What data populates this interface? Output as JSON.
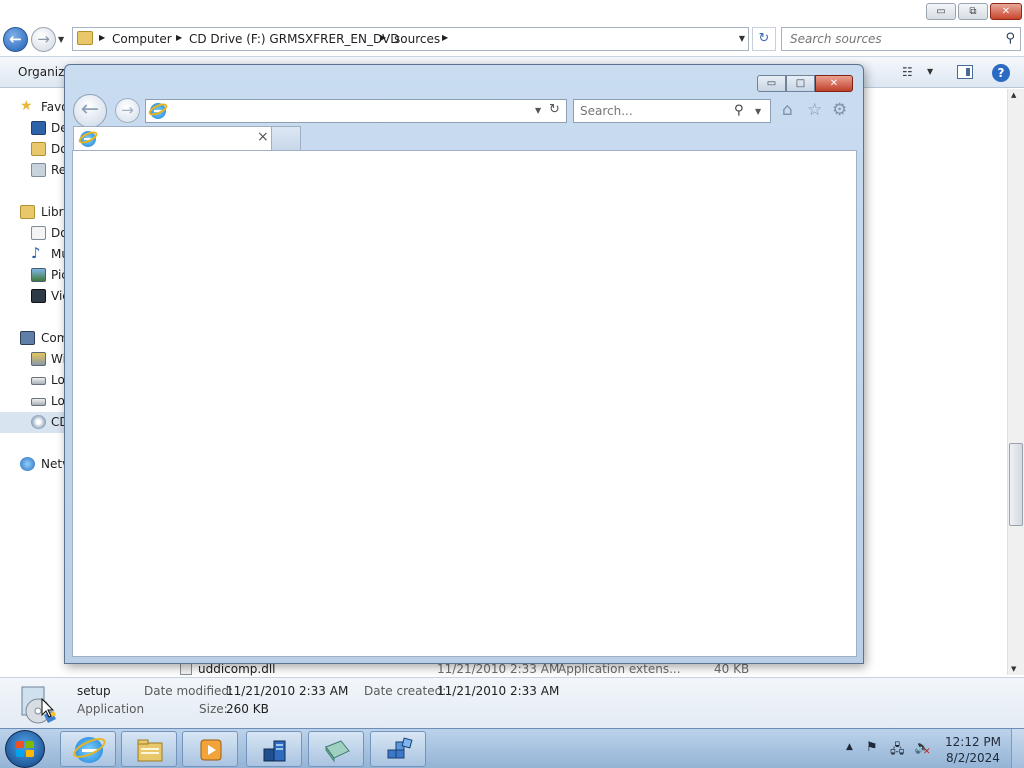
{
  "explorer": {
    "titlebar": {
      "minimize_glyph": "▭",
      "maximize_glyph": "⧉",
      "close_glyph": "✕"
    },
    "nav": {
      "back_glyph": "←",
      "forward_glyph": "→",
      "breadcrumbs": [
        "Computer",
        "CD Drive (F:) GRMSXFRER_EN_DVD",
        "sources"
      ],
      "refresh_glyph": "↻",
      "search_placeholder": "Search sources"
    },
    "toolbar": {
      "organize_label": "Organize",
      "help_glyph": "?"
    },
    "nav_pane": {
      "items": [
        {
          "label": "Favo",
          "icon": "star-icon"
        },
        {
          "label": "De",
          "icon": "desktop-icon"
        },
        {
          "label": "Do",
          "icon": "downloads-icon"
        },
        {
          "label": "Re",
          "icon": "recent-places-icon"
        },
        {
          "label": "Libra",
          "icon": "library-icon"
        },
        {
          "label": "Do",
          "icon": "documents-icon"
        },
        {
          "label": "Mu",
          "icon": "music-icon"
        },
        {
          "label": "Pic",
          "icon": "pictures-icon"
        },
        {
          "label": "Vic",
          "icon": "videos-icon"
        },
        {
          "label": "Com",
          "icon": "computer-icon"
        },
        {
          "label": "Wi",
          "icon": "windows-drive-icon"
        },
        {
          "label": "Lo",
          "icon": "local-disk-icon"
        },
        {
          "label": "Lo",
          "icon": "local-disk-icon"
        },
        {
          "label": "CD",
          "icon": "cd-drive-icon"
        },
        {
          "label": "Netv",
          "icon": "network-icon"
        }
      ]
    },
    "file_row": {
      "name": "uddicomp.dll",
      "date_modified": "11/21/2010 2:33 AM",
      "type": "Application extens...",
      "size": "40 KB"
    },
    "details": {
      "name": "setup",
      "type": "Application",
      "date_modified_label": "Date modified:",
      "date_modified": "11/21/2010 2:33 AM",
      "date_created_label": "Date created:",
      "date_created": "11/21/2010 2:33 AM",
      "size_label": "Size:",
      "size": "260 KB"
    }
  },
  "ie": {
    "caption": {
      "minimize_glyph": "▭",
      "maximize_glyph": "□",
      "close_glyph": "✕"
    },
    "back_glyph": "←",
    "forward_glyph": "→",
    "address_value": "",
    "search_placeholder": "Search...",
    "tab_title": "",
    "tab_close_glyph": "×",
    "toolbar_icons": [
      "home-icon",
      "favorites-star-icon",
      "tools-gear-icon"
    ]
  },
  "taskbar": {
    "pinned": [
      "internet-explorer",
      "windows-explorer",
      "media-player",
      "server-manager",
      "setup-disc",
      "registry-cubes"
    ],
    "clock_time": "12:12 PM",
    "clock_date": "8/2/2024",
    "tray_chevron": "▲"
  }
}
